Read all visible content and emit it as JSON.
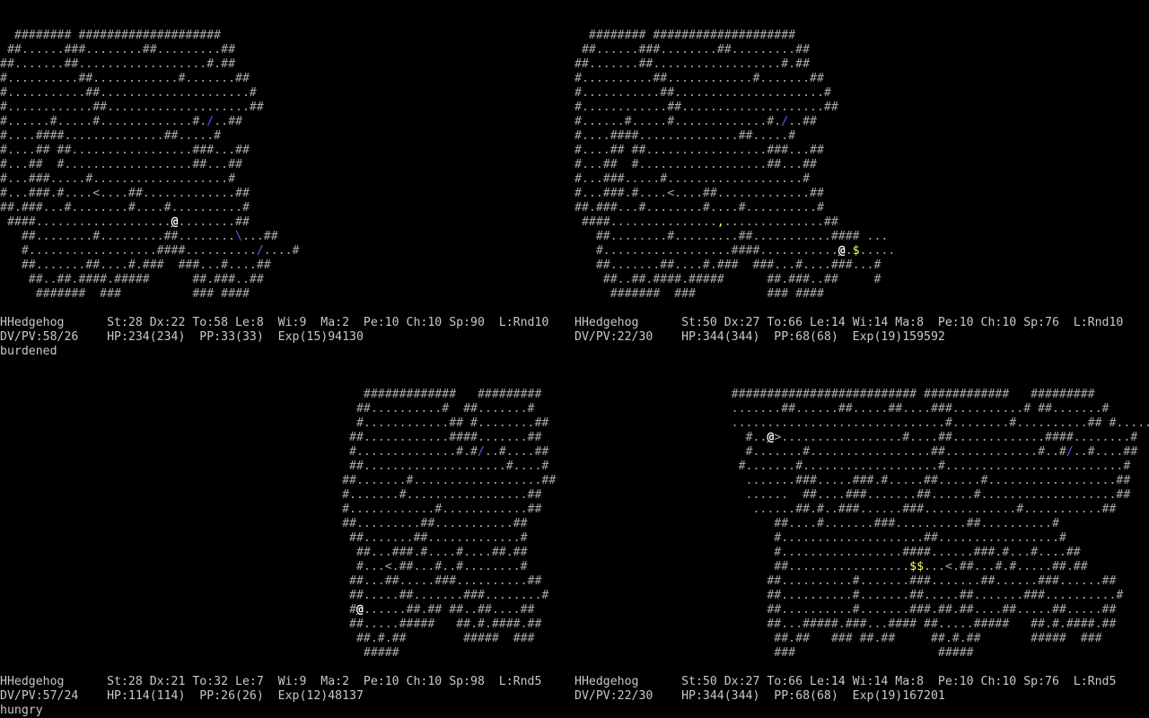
{
  "panels": [
    {
      "map": [
        "  ######## ####################",
        " ##......###........##.........##",
        "##.......##..................#.##",
        "#..........##............#.......##",
        "#...........##.....................#",
        "#............##....................##",
        "#......#.....#.............#./..##",
        "#....####..............##.....#",
        "#....## ##.................###...##",
        "#...##  #..................##...##",
        "#...###.....#...................#",
        "#...###.#....<....##.............##",
        "##.###...#........#....#..........#",
        " ####...................@........##",
        "   ##........#.........##........\\...##",
        "   #..................####........../....#",
        "   ##.......##....#.###  ###...#....##",
        "    ##..##.####.#####      ##.###..##",
        "     #######  ###          ### ####"
      ],
      "status_line_1": "HHedgehog      St:28 Dx:22 To:58 Le:8  Wi:9  Ma:2  Pe:10 Ch:10 Sp:90  L:Rnd10",
      "status_line_2": "DV/PV:58/26    HP:234(234)  PP:33(33)  Exp(15)94130",
      "status_line_3": "burdened"
    },
    {
      "map": [
        "  ######## ####################",
        " ##......###........##.........##",
        "##.......##..................#.##",
        "#..........##............#.......##",
        "#...........##.....................#",
        "#............##....................##",
        "#......#.....#.............#./..##",
        "#....####..............##.....#",
        "#....## ##.................###...##",
        "#...##  #..................##...##",
        "#...###.....#...................#",
        "#...###.#....<....##.............##",
        "##.###...#........#....#..........#",
        " ####...............,..............##",
        "   ##........#.........##...........#### ...",
        "   #..................####...........@.$.....",
        "   ##.......##....#.###  ###...#....###...#",
        "    ##..##.####.#####      ##.###..##     #",
        "     #######  ###          ### ####"
      ],
      "status_line_1": "HHedgehog      St:50 Dx:27 To:66 Le:14 Wi:14 Ma:8  Pe:10 Ch:10 Sp:76  L:Rnd10",
      "status_line_2": "DV/PV:22/30    HP:344(344)  PP:68(68)  Exp(19)159592",
      "status_line_3": ""
    },
    {
      "map": [
        "                                                   #############   #########",
        "                                                  ##..........#  ##.......#",
        "                                                  #............## #........##",
        "                                                 ##............####.......##",
        "                                                 #..............#.#/..#....##",
        "                                                 ##....................#....#",
        "                                                ##.......#..................##",
        "                                                #.......#.................##",
        "                                                #............#............##",
        "                                                ##.........##...........##",
        "                                                 ##.......##.............#",
        "                                                  ##...###.#....#....##.##",
        "                                                  #...<.##...#..#........#",
        "                                                 ##...##.....###..........##",
        "                                                 ##.....##.......###........#",
        "                                                 #@......##.## ##..##....##",
        "                                                 ##.....#####   ##.#.####.##",
        "                                                  ##.#.##        #####  ###",
        "                                                   #####"
      ],
      "status_line_1": "HHedgehog      St:28 Dx:21 To:32 Le:7  Wi:9  Ma:2  Pe:10 Ch:10 Sp:98  L:Rnd5",
      "status_line_2": "DV/PV:57/24    HP:114(114)  PP:26(26)  Exp(12)48137",
      "status_line_3": "hungry"
    },
    {
      "map": [
        "                      ########################## ############   #########",
        "                      .......##......##.....##....###..........# ##.......#",
        "                      ..............................#........#..........## #........#",
        "                        #..@>.................#....##.............####........#",
        "                        #.......#.................##.............#..#/..#....##",
        "                       #.......#...................#.........................#",
        "                        .......###.....###.#.....##......#..................##",
        "                        ......  ##....###.......##......#...................##",
        "                         ......##.#..###......###.............#...........##",
        "                            ##....#.......###..........##..........#",
        "                            #....................##.................#",
        "                            #.................####......###.#...#....##",
        "                            ##.................$$...<.##...#.#.....##.##",
        "                           ##..........#.......###.......##......###......##",
        "                           ##..........#.......##.....##.......###..........#",
        "                           ##..........#.......###.##.##....##.....##.....##",
        "                           ##...#####.###...#### ##.....#####   ##.#.####.##",
        "                            ##.##   ### ##.##     ##.#.##       #####  ###",
        "                            ###                    #####"
      ],
      "status_line_1": "HHedgehog      St:50 Dx:27 To:66 Le:14 Wi:14 Ma:8  Pe:10 Ch:10 Sp:76  L:Rnd5",
      "status_line_2": "DV/PV:22/30    HP:344(344)  PP:68(68)  Exp(19)167201",
      "status_line_3": ""
    }
  ],
  "colors": {
    "background": "#000000",
    "wall_floor": "#a8a8a8",
    "status_text": "#c8c8c8",
    "player": "#ffffff",
    "item_blue": "#5a5aff",
    "gold": "#ffff55"
  },
  "glyph_meanings": {
    "@": "player",
    "#": "wall",
    ".": "floor",
    "<": "stairs-up",
    ">": "stairs-down",
    "$": "gold",
    "/": "wand",
    "[": "armor",
    "\\": "weapon",
    ",": "item"
  }
}
